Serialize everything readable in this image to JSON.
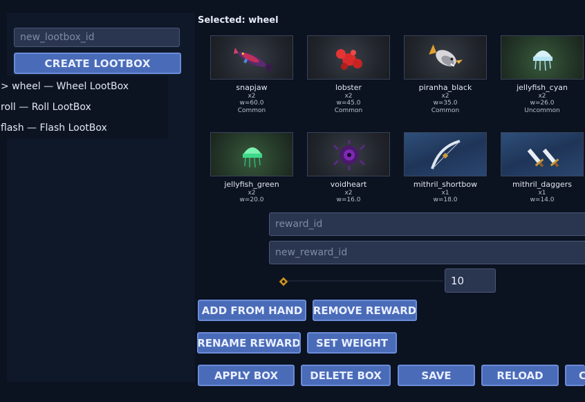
{
  "left": {
    "new_lootbox_placeholder": "new_lootbox_id",
    "create_label": "CREATE LOOTBOX",
    "boxes": [
      {
        "label": "> wheel — Wheel LootBox"
      },
      {
        "label": "roll — Roll LootBox"
      },
      {
        "label": "flash — Flash LootBox"
      }
    ]
  },
  "selected_label": "Selected: wheel",
  "rewards": [
    {
      "name": "snapjaw",
      "qty": "x2",
      "weight": "w=60.0",
      "rarity": "Common",
      "icon": "snapjaw-fish-icon",
      "bg": "dark"
    },
    {
      "name": "lobster",
      "qty": "x2",
      "weight": "w=45.0",
      "rarity": "Common",
      "icon": "lobster-icon",
      "bg": "dark"
    },
    {
      "name": "piranha_black",
      "qty": "x2",
      "weight": "w=35.0",
      "rarity": "Common",
      "icon": "piranha-icon",
      "bg": "dark"
    },
    {
      "name": "jellyfish_cyan",
      "qty": "x2",
      "weight": "w=26.0",
      "rarity": "Uncommon",
      "icon": "jellyfish-cyan-icon",
      "bg": "green"
    },
    {
      "name": "jellyfish_green",
      "qty": "x2",
      "weight": "w=20.0",
      "rarity": "",
      "icon": "jellyfish-green-icon",
      "bg": "green"
    },
    {
      "name": "voidheart",
      "qty": "x2",
      "weight": "w=16.0",
      "rarity": "",
      "icon": "voidheart-icon",
      "bg": "dark"
    },
    {
      "name": "mithril_shortbow",
      "qty": "x1",
      "weight": "w=18.0",
      "rarity": "",
      "icon": "shortbow-icon",
      "bg": "blue"
    },
    {
      "name": "mithril_daggers",
      "qty": "x1",
      "weight": "w=14.0",
      "rarity": "",
      "icon": "daggers-icon",
      "bg": "blue"
    }
  ],
  "form": {
    "reward_id_placeholder": "reward_id",
    "new_reward_id_placeholder": "new_reward_id",
    "weight_value": "10"
  },
  "buttons": {
    "add_from_hand": "ADD FROM HAND",
    "remove_reward": "REMOVE REWARD",
    "rename_reward": "RENAME REWARD",
    "set_weight": "SET WEIGHT",
    "apply_box": "APPLY BOX",
    "delete_box": "DELETE BOX",
    "save": "SAVE",
    "reload": "RELOAD",
    "cut_off": "C"
  },
  "colors": {
    "background": "#0b1220",
    "button": "#4a6bb8",
    "button_border": "#6b8cd8",
    "input": "#2a3550"
  }
}
